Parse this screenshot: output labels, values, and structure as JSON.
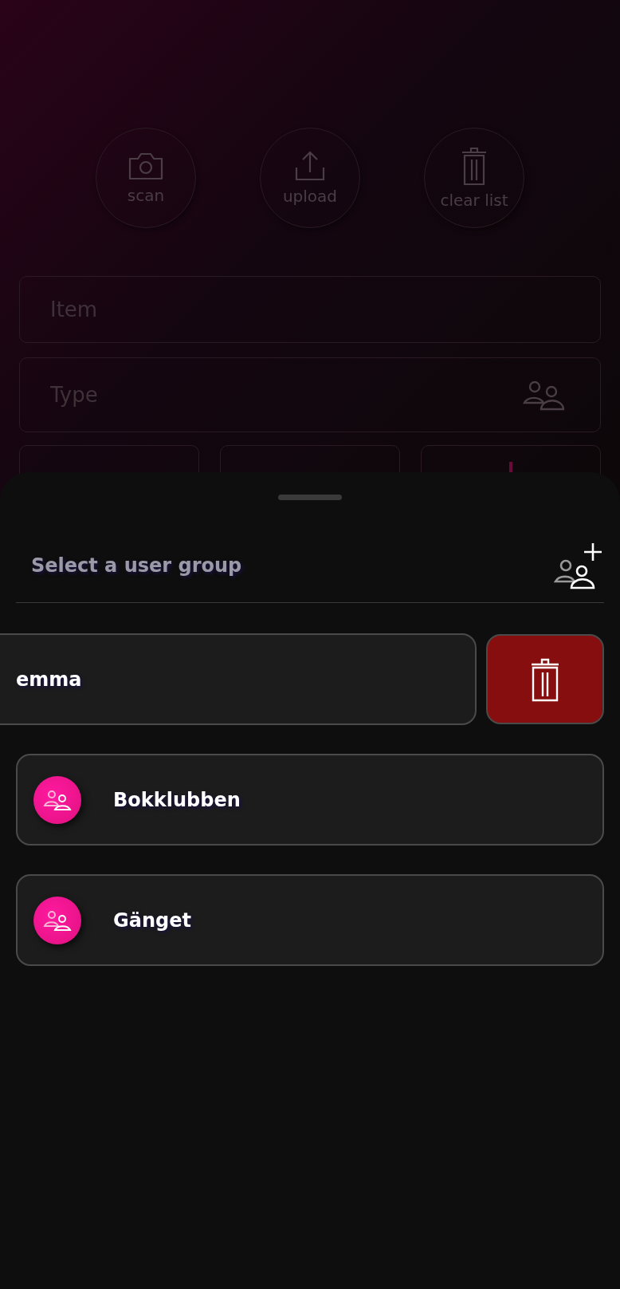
{
  "actions": [
    {
      "kind": "camera",
      "label": "scan"
    },
    {
      "kind": "upload",
      "label": "upload"
    },
    {
      "kind": "trash",
      "label": "clear list"
    }
  ],
  "fields": [
    {
      "placeholder": "Item",
      "icon": false
    },
    {
      "placeholder": "Type",
      "icon": true
    }
  ],
  "sheet": {
    "title": "Select a user group",
    "groups": [
      {
        "name": "emma",
        "swiped": true
      },
      {
        "name": "Bokklubben",
        "swiped": false
      },
      {
        "name": "Gänget",
        "swiped": false
      }
    ]
  }
}
